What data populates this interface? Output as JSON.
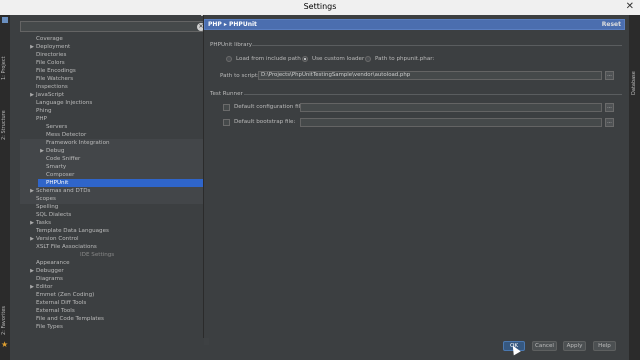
{
  "window": {
    "title": "Settings"
  },
  "left_strip": {
    "tab_project": "1: Project",
    "tab_structure": "2: Structure",
    "tab_favorites": "2: Favorites"
  },
  "right_strip": {
    "tab_database": "Database"
  },
  "search": {
    "placeholder": "",
    "clear_icon": "clear-search-icon"
  },
  "tree": {
    "items": [
      {
        "label": "Coverage",
        "arrow": false
      },
      {
        "label": "Deployment",
        "arrow": true
      },
      {
        "label": "Directories",
        "arrow": false
      },
      {
        "label": "File Colors",
        "arrow": false
      },
      {
        "label": "File Encodings",
        "arrow": false
      },
      {
        "label": "File Watchers",
        "arrow": false
      },
      {
        "label": "Inspections",
        "arrow": false
      },
      {
        "label": "JavaScript",
        "arrow": true
      },
      {
        "label": "Language Injections",
        "arrow": false
      },
      {
        "label": "Phing",
        "arrow": false
      },
      {
        "label": "PHP",
        "arrow": false
      }
    ],
    "php_children": [
      {
        "label": "Servers",
        "arrow": false
      },
      {
        "label": "Mess Detector",
        "arrow": false
      },
      {
        "label": "Framework Integration",
        "arrow": false
      },
      {
        "label": "Debug",
        "arrow": true
      },
      {
        "label": "Code Sniffer",
        "arrow": false
      },
      {
        "label": "Smarty",
        "arrow": false
      },
      {
        "label": "Composer",
        "arrow": false
      },
      {
        "label": "PHPUnit",
        "arrow": false,
        "selected": true
      }
    ],
    "items_after": [
      {
        "label": "Schemas and DTDs",
        "arrow": true
      },
      {
        "label": "Scopes",
        "arrow": false
      },
      {
        "label": "Spelling",
        "arrow": false
      },
      {
        "label": "SQL Dialects",
        "arrow": false
      },
      {
        "label": "Tasks",
        "arrow": true
      },
      {
        "label": "Template Data Languages",
        "arrow": false
      },
      {
        "label": "Version Control",
        "arrow": true
      },
      {
        "label": "XSLT File Associations",
        "arrow": false
      }
    ],
    "ide_group_label": "IDE Settings",
    "ide_items": [
      {
        "label": "Appearance",
        "arrow": false
      },
      {
        "label": "Debugger",
        "arrow": true
      },
      {
        "label": "Diagrams",
        "arrow": false
      },
      {
        "label": "Editor",
        "arrow": true
      },
      {
        "label": "Emmet (Zen Coding)",
        "arrow": false
      },
      {
        "label": "External Diff Tools",
        "arrow": false
      },
      {
        "label": "External Tools",
        "arrow": false
      },
      {
        "label": "File and Code Templates",
        "arrow": false
      },
      {
        "label": "File Types",
        "arrow": false
      }
    ]
  },
  "content": {
    "breadcrumb": "PHP ▸ PHPUnit",
    "reset_label": "Reset",
    "library_section": "PHPUnit library",
    "radio_include_path": "Load from include path",
    "radio_custom_loader": "Use custom loader",
    "radio_phar": "Path to phpunit.phar:",
    "selected_radio": "custom_loader",
    "path_label": "Path to script:",
    "path_value": "D:\\Projects\\PhpUnitTestingSample\\vendor\\autoload.php",
    "browse_label": "...",
    "runner_section": "Test Runner",
    "default_config_label": "Default configuration file:",
    "default_bootstrap_label": "Default bootstrap file:"
  },
  "buttons": {
    "ok": "OK",
    "cancel": "Cancel",
    "apply": "Apply",
    "help": "Help"
  },
  "colors": {
    "background": "#3c3f41",
    "selection": "#2f65ca",
    "breadcrumb": "#4b6eaf"
  }
}
